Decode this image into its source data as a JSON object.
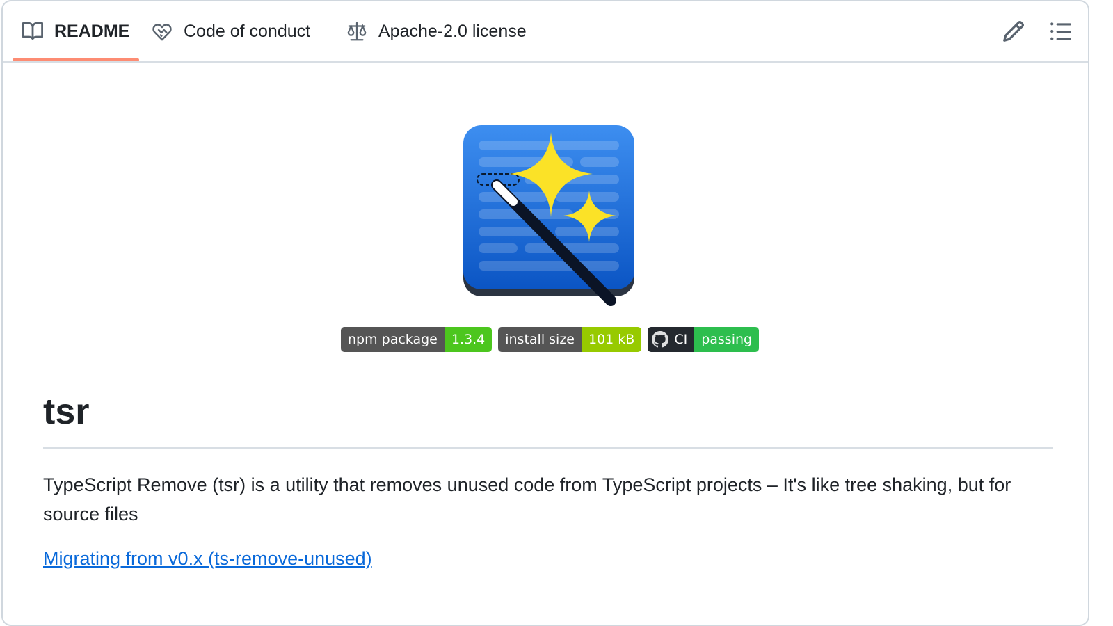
{
  "tabs": [
    {
      "label": "README",
      "icon": "book-icon",
      "active": true
    },
    {
      "label": "Code of conduct",
      "icon": "heart-handshake-icon",
      "active": false
    },
    {
      "label": "Apache-2.0 license",
      "icon": "scale-icon",
      "active": false
    }
  ],
  "toolbar": {
    "edit_icon": "pencil-icon",
    "outline_icon": "list-unordered-icon"
  },
  "logo": {
    "alt": "tsr logo - magic wand over document"
  },
  "badges": [
    {
      "label": "npm package",
      "value": "1.3.4",
      "color": "#4cc61e"
    },
    {
      "label": "install size",
      "value": "101 kB",
      "color": "#97ca00"
    },
    {
      "label": "CI",
      "value": "passing",
      "color": "#2dbe4e",
      "icon": "github-icon"
    }
  ],
  "content": {
    "title": "tsr",
    "description": "TypeScript Remove (tsr) is a utility that removes unused code from TypeScript projects – It's like tree shaking, but for source files",
    "link_text": "Migrating from v0.x (ts-remove-unused)"
  },
  "colors": {
    "accent_underline": "#fd8c73",
    "link": "#0969da"
  }
}
